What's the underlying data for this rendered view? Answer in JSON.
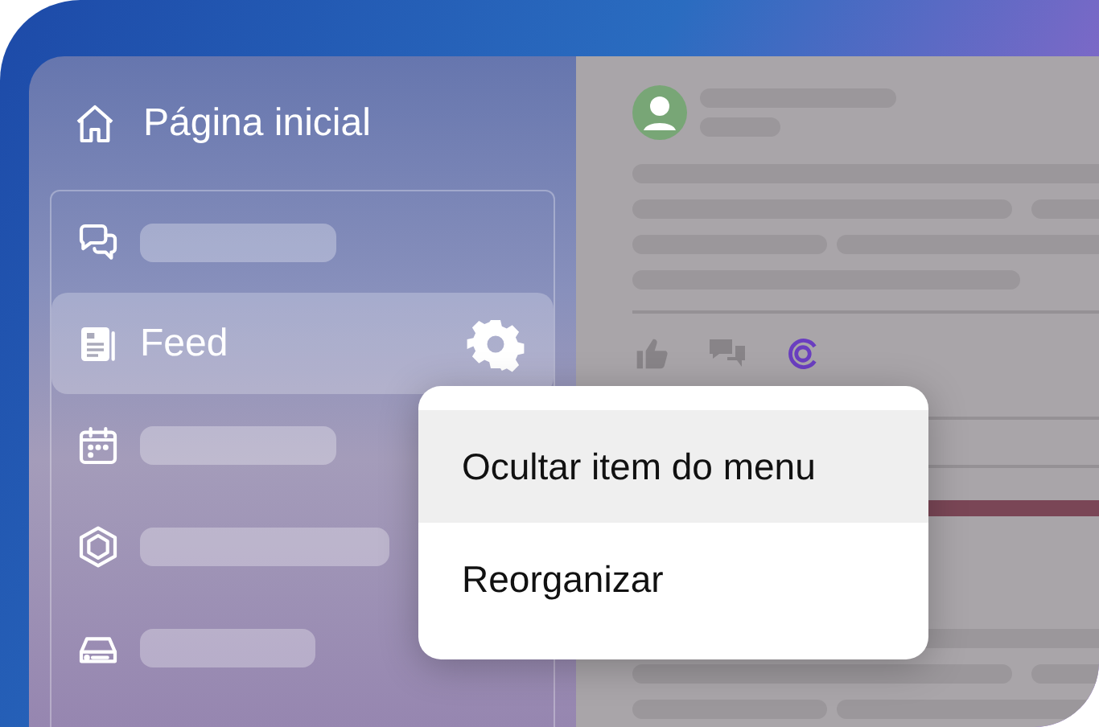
{
  "sidebar": {
    "home": {
      "label": "Página inicial"
    },
    "items": [
      {
        "kind": "skeleton",
        "selected": false
      },
      {
        "kind": "text",
        "label": "Feed",
        "selected": true
      },
      {
        "kind": "skeleton",
        "selected": false
      },
      {
        "kind": "skeleton",
        "selected": false
      },
      {
        "kind": "skeleton",
        "selected": false
      }
    ]
  },
  "context_menu": {
    "items": [
      {
        "label": "Ocultar item do menu",
        "selected": true
      },
      {
        "label": "Reorganizar",
        "selected": false
      }
    ]
  }
}
